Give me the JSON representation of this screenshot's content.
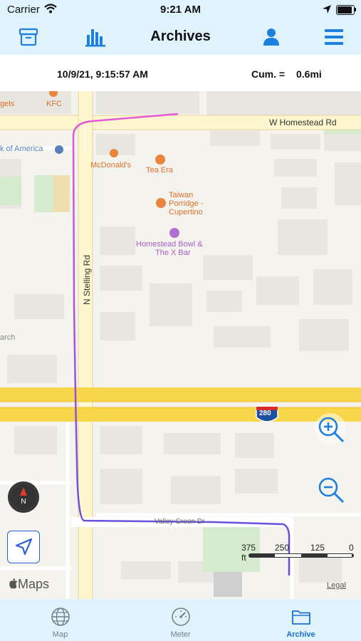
{
  "status_bar": {
    "carrier": "Carrier",
    "time": "9:21 AM"
  },
  "nav": {
    "title": "Archives",
    "icons": [
      "archive-box-icon",
      "bar-chart-icon",
      "person-icon",
      "hamburger-menu-icon"
    ]
  },
  "info": {
    "datetime": "10/9/21, 9:15:57 AM",
    "cum_label": "Cum. =",
    "cum_value": "0.6mi"
  },
  "map": {
    "roads": {
      "homestead": "W Homestead Rd",
      "stelling": "N Stelling Rd",
      "valley": "Valley Green Dr",
      "interstate": "280"
    },
    "pois": {
      "kfc": "KFC",
      "mcdonalds": "McDonald's",
      "tea_era": "Tea Era",
      "taiwan": [
        "Taiwan",
        "Porridge -",
        "Cupertino"
      ],
      "homestead_bowl": [
        "Homestead Bowl &",
        "The X Bar"
      ],
      "bank": "k of America",
      "bagels": "gels",
      "church": "arch"
    },
    "compass_letter": "N",
    "attribution": "Maps",
    "legal": "Legal",
    "scale": {
      "left": "375 ft",
      "ticks": [
        "250",
        "125",
        "0"
      ]
    },
    "route_colors": {
      "start": "#e45ad8",
      "end": "#5a4fe0"
    }
  },
  "tabs": [
    {
      "label": "Map",
      "icon": "globe-icon",
      "active": false
    },
    {
      "label": "Meter",
      "icon": "gauge-icon",
      "active": false
    },
    {
      "label": "Archive",
      "icon": "folder-icon",
      "active": true
    }
  ]
}
